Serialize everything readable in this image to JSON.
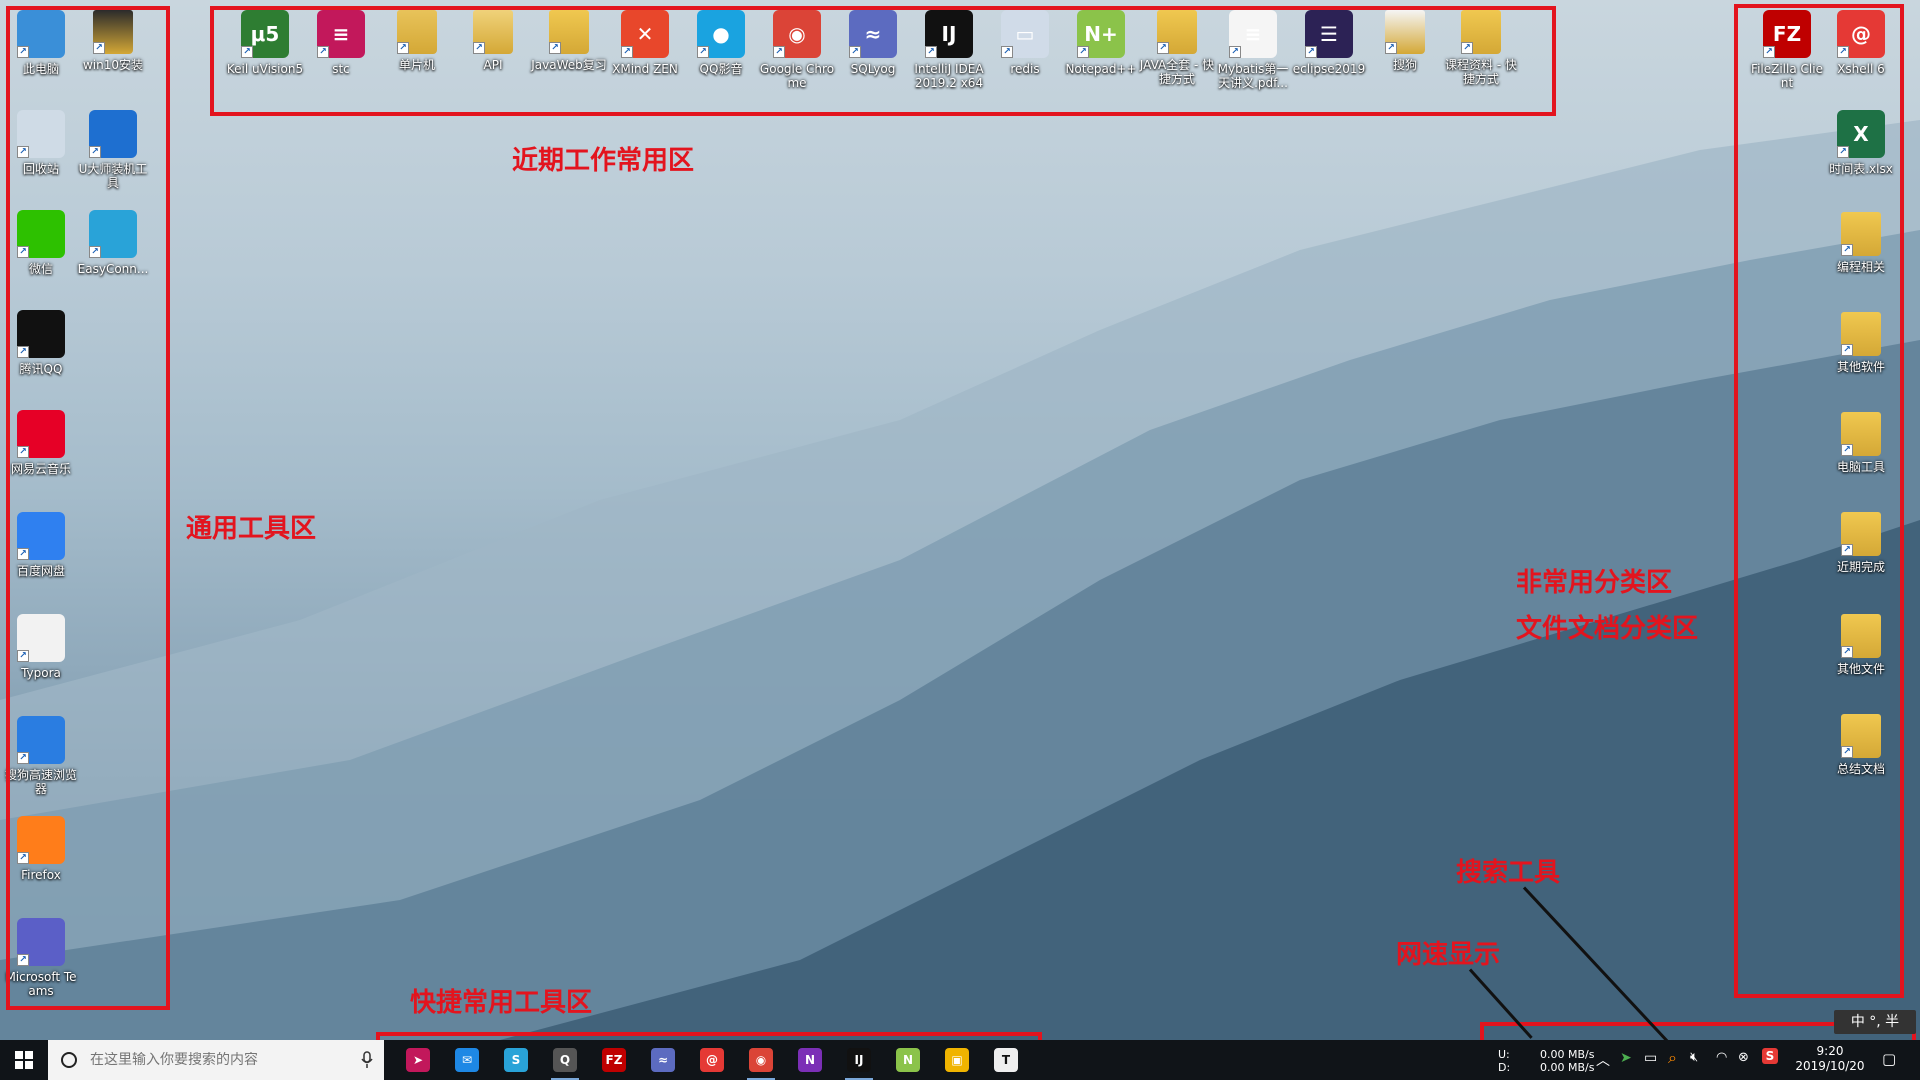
{
  "colors": {
    "annotation": "#e3141e",
    "taskbar": "#101418"
  },
  "left_icons": [
    {
      "label": "此电脑",
      "icon": "computer-icon",
      "color": "#3a8fd8"
    },
    {
      "label": "win10安装",
      "icon": "folder-icon",
      "color": "#2b2b2b"
    },
    {
      "label": "回收站",
      "icon": "recycle-bin-icon",
      "color": "#cfdbe6"
    },
    {
      "label": "U大师装机工具",
      "icon": "u-master-icon",
      "color": "#1e6fd0"
    },
    {
      "label": "微信",
      "icon": "wechat-icon",
      "color": "#2dc100"
    },
    {
      "label": "EasyConn...",
      "icon": "easyconnect-icon",
      "color": "#29a3d8"
    },
    {
      "label": "腾讯QQ",
      "icon": "qq-icon",
      "color": "#111111"
    },
    {
      "label": "网易云音乐",
      "icon": "netease-music-icon",
      "color": "#e60026"
    },
    {
      "label": "百度网盘",
      "icon": "baidu-netdisk-icon",
      "color": "#2f80f0"
    },
    {
      "label": "Typora",
      "icon": "typora-icon",
      "color": "#f2f2f2"
    },
    {
      "label": "搜狗高速浏览器",
      "icon": "sogou-browser-icon",
      "color": "#2a7de1"
    },
    {
      "label": "Firefox",
      "icon": "firefox-icon",
      "color": "#ff7d1a"
    },
    {
      "label": "Microsoft Teams",
      "icon": "teams-icon",
      "color": "#5b5fc7"
    }
  ],
  "top_icons": [
    {
      "label": "Keil uVision5",
      "icon": "keil-icon",
      "color": "#2e7d32",
      "glyph": "μ5"
    },
    {
      "label": "stc",
      "icon": "stc-icon",
      "color": "#c2185b",
      "glyph": "≡"
    },
    {
      "label": "单片机",
      "icon": "folder-icon",
      "color": "#e8c35a",
      "glyph": ""
    },
    {
      "label": "API",
      "icon": "folder-icon",
      "color": "#f0d27a",
      "glyph": ""
    },
    {
      "label": "JavaWeb复习",
      "icon": "folder-icon",
      "color": "#f0c850",
      "glyph": ""
    },
    {
      "label": "XMind ZEN",
      "icon": "xmind-icon",
      "color": "#e8472b",
      "glyph": "✕"
    },
    {
      "label": "QQ影音",
      "icon": "qq-player-icon",
      "color": "#1aa3e0",
      "glyph": "●"
    },
    {
      "label": "Google Chrome",
      "icon": "chrome-icon",
      "color": "#db4437",
      "glyph": "◉"
    },
    {
      "label": "SQLyog",
      "icon": "sqlyog-icon",
      "color": "#5c6bc0",
      "glyph": "≈"
    },
    {
      "label": "IntelliJ IDEA 2019.2 x64",
      "icon": "intellij-icon",
      "color": "#111111",
      "glyph": "IJ"
    },
    {
      "label": "redis",
      "icon": "redis-icon",
      "color": "#d0dbe8",
      "glyph": "▭"
    },
    {
      "label": "Notepad++",
      "icon": "notepadpp-icon",
      "color": "#8bc34a",
      "glyph": "N+"
    },
    {
      "label": "JAVA全套 - 快捷方式",
      "icon": "folder-icon",
      "color": "#f0c850",
      "glyph": ""
    },
    {
      "label": "Mybatis第一天讲义.pdf...",
      "icon": "pdf-icon",
      "color": "#f5f5f5",
      "glyph": "≡"
    },
    {
      "label": "eclipse2019",
      "icon": "eclipse-icon",
      "color": "#2c2255",
      "glyph": "☰"
    },
    {
      "label": "搜狗",
      "icon": "folder-icon",
      "color": "#f5f5f5",
      "glyph": ""
    },
    {
      "label": "课程资料 - 快捷方式",
      "icon": "folder-icon",
      "color": "#f0c850",
      "glyph": ""
    }
  ],
  "right_icons": [
    {
      "label": "FileZilla Client",
      "icon": "filezilla-icon",
      "color": "#bf0000",
      "glyph": "FZ"
    },
    {
      "label": "Xshell 6",
      "icon": "xshell-icon",
      "color": "#e53935",
      "glyph": "@"
    },
    {
      "label": "时间表.xlsx",
      "icon": "excel-icon",
      "color": "#1e7145",
      "glyph": "X"
    },
    {
      "label": "编程相关",
      "icon": "folder-icon",
      "color": "#f0c850",
      "glyph": ""
    },
    {
      "label": "其他软件",
      "icon": "folder-icon",
      "color": "#f0c850",
      "glyph": ""
    },
    {
      "label": "电脑工具",
      "icon": "folder-icon",
      "color": "#f0c850",
      "glyph": ""
    },
    {
      "label": "近期完成",
      "icon": "folder-icon",
      "color": "#f0c850",
      "glyph": ""
    },
    {
      "label": "其他文件",
      "icon": "folder-icon",
      "color": "#f0c850",
      "glyph": ""
    },
    {
      "label": "总结文档",
      "icon": "folder-icon",
      "color": "#f0c850",
      "glyph": ""
    }
  ],
  "annotations": {
    "recent_work": "近期工作常用区",
    "general_tools": "通用工具区",
    "uncommon_category": "非常用分类区",
    "doc_category": "文件文档分类区",
    "search_tool": "搜索工具",
    "net_speed": "网速显示",
    "quick_tools": "快捷常用工具区"
  },
  "taskbar": {
    "search_placeholder": "在这里输入你要搜索的内容",
    "apps": [
      {
        "icon": "paper-plane-icon",
        "color": "#c2185b",
        "glyph": "➤"
      },
      {
        "icon": "mail-icon",
        "color": "#1e88e5",
        "glyph": "✉"
      },
      {
        "icon": "easyconnect-icon",
        "color": "#29a3d8",
        "glyph": "S"
      },
      {
        "icon": "qq-icon",
        "color": "#555555",
        "glyph": "Q"
      },
      {
        "icon": "filezilla-icon",
        "color": "#bf0000",
        "glyph": "FZ"
      },
      {
        "icon": "sqlyog-icon",
        "color": "#5c6bc0",
        "glyph": "≈"
      },
      {
        "icon": "xshell-icon",
        "color": "#e53935",
        "glyph": "@"
      },
      {
        "icon": "chrome-icon",
        "color": "#db4437",
        "glyph": "◉"
      },
      {
        "icon": "onenote-icon",
        "color": "#7b2fb6",
        "glyph": "N"
      },
      {
        "icon": "intellij-icon",
        "color": "#111111",
        "glyph": "IJ"
      },
      {
        "icon": "notepadpp-icon",
        "color": "#8bc34a",
        "glyph": "N"
      },
      {
        "icon": "explorer-icon",
        "color": "#f0b400",
        "glyph": "▣"
      },
      {
        "icon": "typora-icon",
        "color": "#eeeeee",
        "glyph": "T"
      }
    ],
    "net_upload_label": "U:",
    "net_download_label": "D:",
    "net_upload": "0.00 MB/s",
    "net_download": "0.00 MB/s",
    "ime": "中 °, 半",
    "time": "9:20",
    "date": "2019/10/20"
  }
}
